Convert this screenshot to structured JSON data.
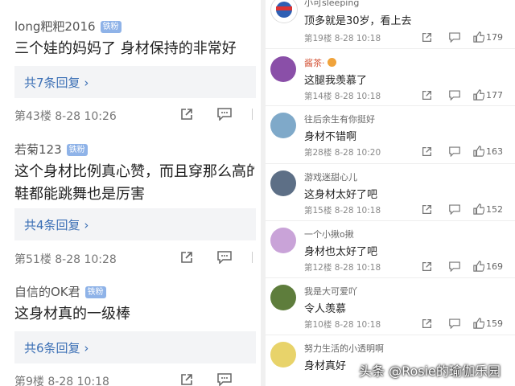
{
  "left_comments": [
    {
      "username": "long粑粑2016",
      "badge": "铁粉",
      "lines": [
        "三个娃的妈妈了 身材保持的非常好"
      ],
      "replies": "共7条回复",
      "meta": "第43楼 8-28 10:26"
    },
    {
      "username": "若菊123",
      "badge": "铁粉",
      "lines": [
        "这个身材比例真心赞，而且穿那么高的",
        "鞋都能跳舞也是厉害"
      ],
      "replies": "共4条回复",
      "meta": "第51楼 8-28 10:28"
    },
    {
      "username": "自信的OK君",
      "badge": "铁粉",
      "lines": [
        "这身材真的一级棒"
      ],
      "replies": "共6条回复",
      "meta": "第9楼 8-28 10:18"
    }
  ],
  "right_partial_top": {
    "name": "小可sleeping",
    "text": "顶多就是30岁，看上去",
    "meta": "第19楼 8-28 10:18",
    "likes": "179"
  },
  "right_comments": [
    {
      "name": "酱茶·",
      "text": "这腿我羡慕了",
      "meta": "第14楼 8-28 10:18",
      "likes": "177",
      "avatar_color": "#8a4fa8"
    },
    {
      "name": "往后余生有你挺好",
      "text": "身材不错啊",
      "meta": "第28楼 8-28 10:20",
      "likes": "163",
      "avatar_color": "#7fa9c9"
    },
    {
      "name": "游戏迷甜心儿",
      "text": "这身材太好了吧",
      "meta": "第15楼 8-28 10:18",
      "likes": "152",
      "avatar_color": "#5d6f86"
    },
    {
      "name": "一个小揪o揪",
      "text": "身材也太好了吧",
      "meta": "第12楼 8-28 10:18",
      "likes": "169",
      "avatar_color": "#c9a3d8"
    },
    {
      "name": "我是大可爱吖",
      "text": "令人羡慕",
      "meta": "第10楼 8-28 10:18",
      "likes": "159",
      "avatar_color": "#5e7d3c"
    },
    {
      "name": "努力生活的小透明啊",
      "text": "身材真好",
      "meta": "",
      "likes": "",
      "avatar_color": "#e8d36a"
    }
  ],
  "watermark": "头条 @Rosie的瑜伽乐园",
  "colors": {
    "badge": "#8fb3e8",
    "reply_link": "#3b6fb5",
    "reply_bg": "#f3f4f6"
  }
}
